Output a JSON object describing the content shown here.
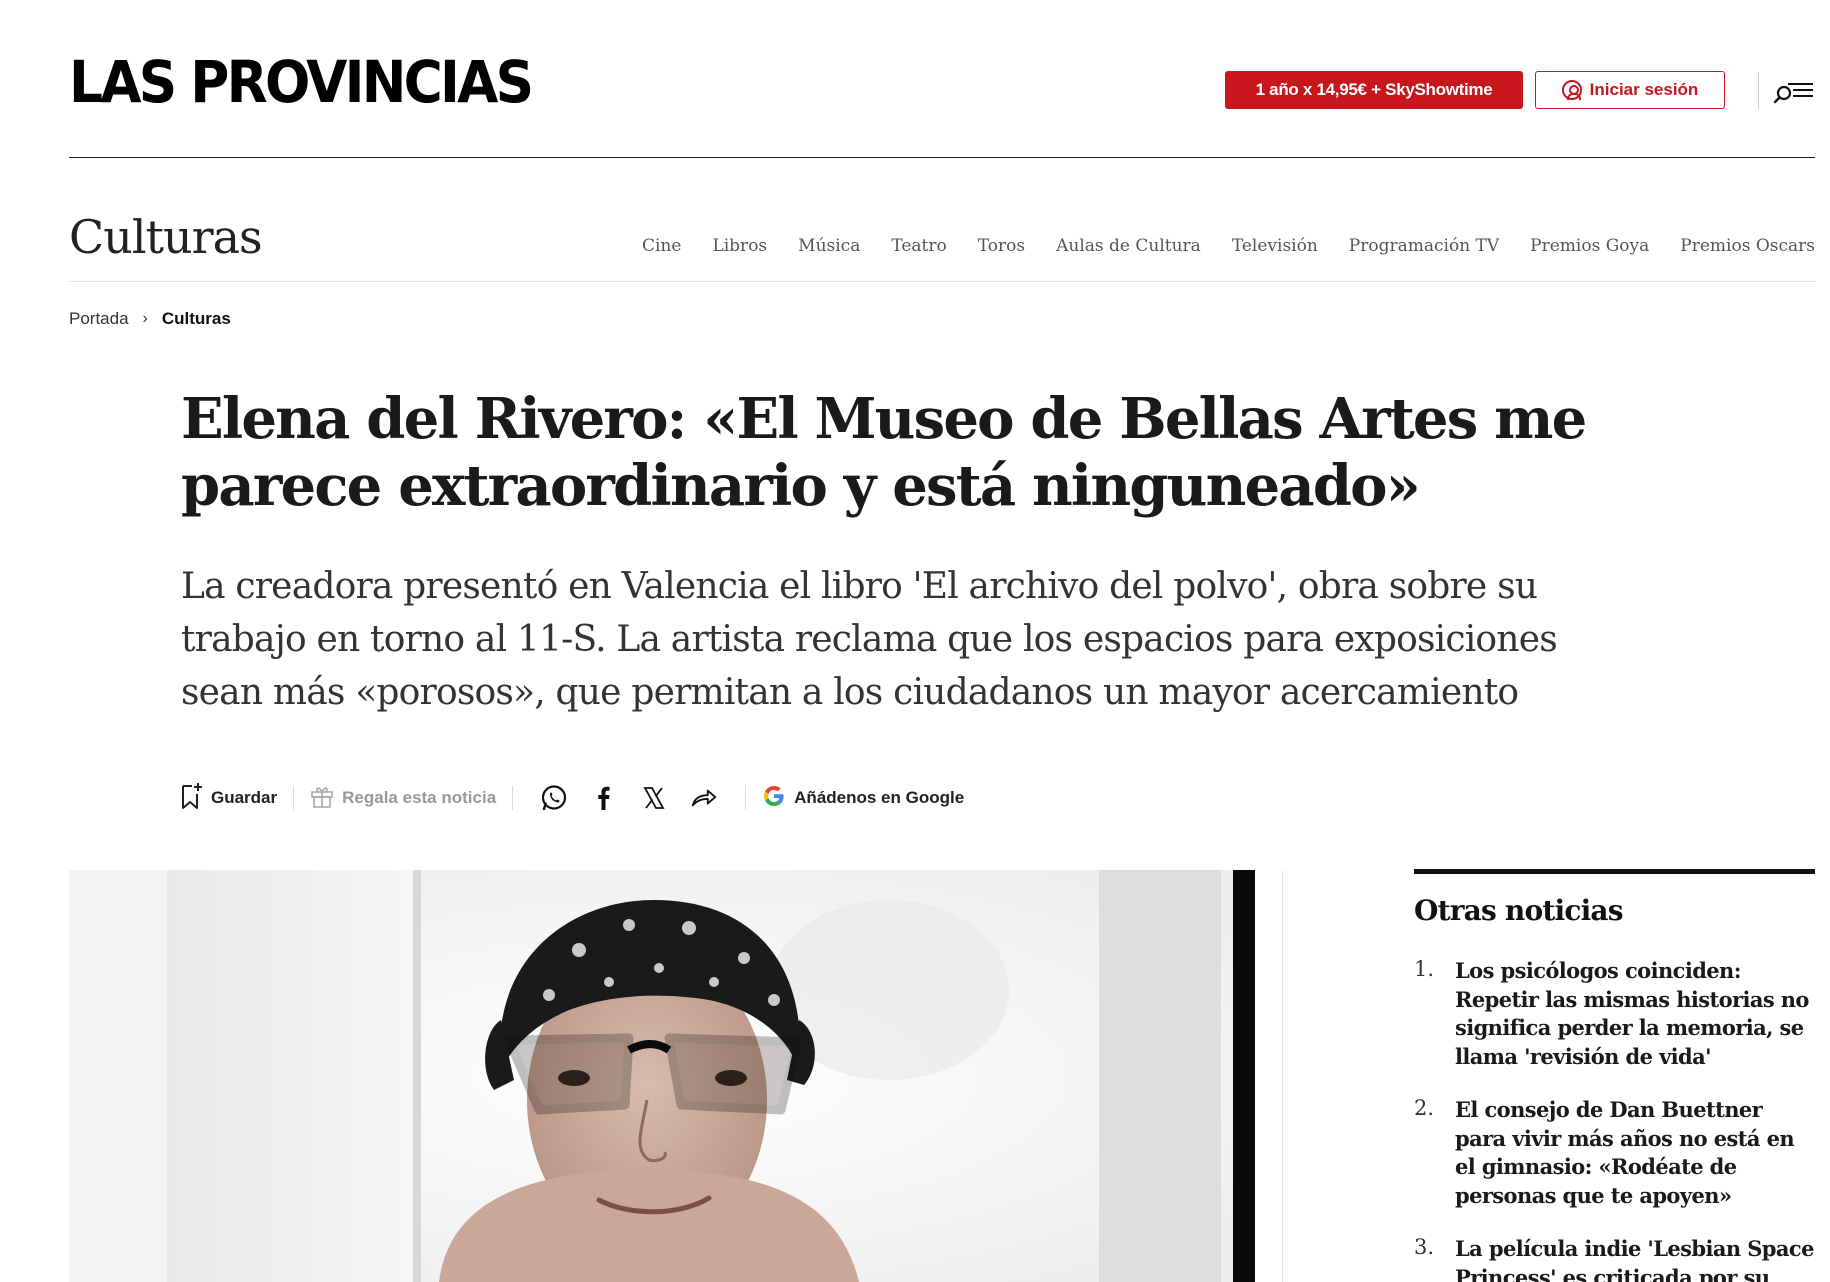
{
  "header": {
    "logo": "LAS PROVINCIAS",
    "promo_label": "1 año x 14,95€ + SkyShowtime",
    "login_label": "Iniciar sesión"
  },
  "section": {
    "title": "Culturas",
    "nav": [
      "Cine",
      "Libros",
      "Música",
      "Teatro",
      "Toros",
      "Aulas de Cultura",
      "Televisión",
      "Programación TV",
      "Premios Goya",
      "Premios Oscars"
    ]
  },
  "breadcrumb": {
    "home": "Portada",
    "current": "Culturas"
  },
  "article": {
    "headline": "Elena del Rivero: «El Museo de Bellas Artes me parece extraordinario y está ninguneado»",
    "subhead": "La creadora presentó en Valencia el libro 'El archivo del polvo', obra sobre su trabajo en torno al 11-S. La artista reclama que los espacios para exposiciones sean más «porosos», que permitan a los ciudadanos un mayor acercamiento"
  },
  "sharebar": {
    "save_label": "Guardar",
    "gift_label": "Regala esta noticia",
    "google_label": "Añádenos en Google"
  },
  "sidebar": {
    "title": "Otras noticias",
    "items": [
      {
        "num": "1.",
        "text": "Los psicólogos coinciden: Repetir las mismas historias no significa perder la memoria, se llama 'revisión de vida'"
      },
      {
        "num": "2.",
        "text": "El consejo de Dan Buettner para vivir más años no está en el gimnasio: «Rodéate de personas que te apoyen»"
      },
      {
        "num": "3.",
        "text": "La película indie 'Lesbian Space Princess' es criticada por su"
      }
    ]
  },
  "colors": {
    "brand_red": "#c8161d",
    "text": "#1a1a1a"
  }
}
